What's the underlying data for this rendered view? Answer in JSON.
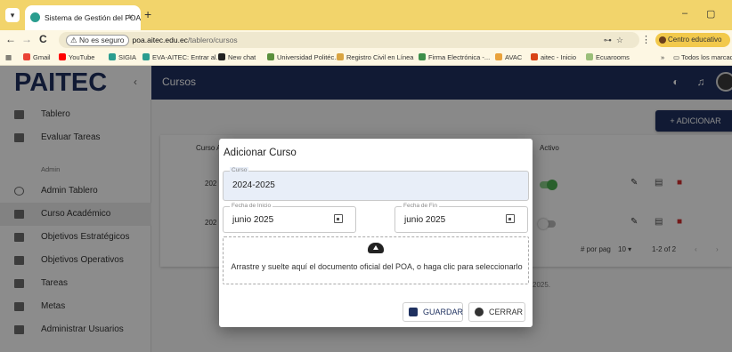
{
  "browser": {
    "tab_title": "Sistema de Gestión del POA",
    "tab_close": "×",
    "new_tab": "+",
    "minimize": "–",
    "restore": "▢",
    "close": "×",
    "nav_back": "←",
    "nav_forward": "→",
    "nav_reload": "C",
    "security_label": "⚠ No es seguro",
    "url_host": "poa.aitec.edu.ec",
    "url_path": "/tablero/cursos",
    "profile_label": "Centro educativo",
    "all_bookmarks": "Todos los marcadores",
    "bookmarks": [
      "Gmail",
      "YouTube",
      "SIGIA",
      "EVA-AITEC: Entrar al...",
      "New chat",
      "Universidad Politéc...",
      "Registro Civil en Línea",
      "Firma Electrónica -...",
      "AVAC",
      "aitec - Inicio",
      "Ecuarooms"
    ]
  },
  "app": {
    "logo": "PAITEC",
    "topbar_title": "Cursos",
    "add_button": "+ ADICIONAR"
  },
  "sidebar": {
    "items": [
      {
        "label": "Tablero",
        "icon": "dashboard-icon"
      },
      {
        "label": "Evaluar Tareas",
        "icon": "clipboard-icon"
      },
      {
        "label": "Admin Tablero",
        "icon": "circle-icon"
      },
      {
        "label": "Curso Académico",
        "icon": "book-icon"
      },
      {
        "label": "Objetivos Estratégicos",
        "icon": "list-icon"
      },
      {
        "label": "Objetivos Operativos",
        "icon": "list-icon"
      },
      {
        "label": "Tareas",
        "icon": "list-icon"
      },
      {
        "label": "Metas",
        "icon": "flag-icon"
      },
      {
        "label": "Administrar Usuarios",
        "icon": "users-icon"
      }
    ],
    "section_admin": "Admin"
  },
  "table": {
    "headers": [
      "Curso A",
      "Activo"
    ],
    "rows": [
      {
        "curso": "202",
        "active": true
      },
      {
        "curso": "202",
        "active": false
      }
    ],
    "per_page_label": "# por pag",
    "per_page_value": "10 ▾",
    "range": "1-2 of 2",
    "footnote": "2025."
  },
  "dialog": {
    "title": "Adicionar Curso",
    "curso_label": "Curso",
    "curso_value": "2024-2025",
    "inicio_label": "Fecha de Inicio",
    "inicio_value": "junio 2025",
    "fin_label": "Fecha de Fin",
    "fin_value": "junio 2025",
    "dropzone_text": "Arrastre y suelte aquí el documento oficial del POA, o haga clic para seleccionarlo",
    "save_button": "GUARDAR",
    "close_button": "CERRAR"
  },
  "colors": {
    "navy": "#1f3160",
    "chrome_yellow": "#f2d46b",
    "danger": "#d32f2f",
    "success": "#4caf50"
  }
}
